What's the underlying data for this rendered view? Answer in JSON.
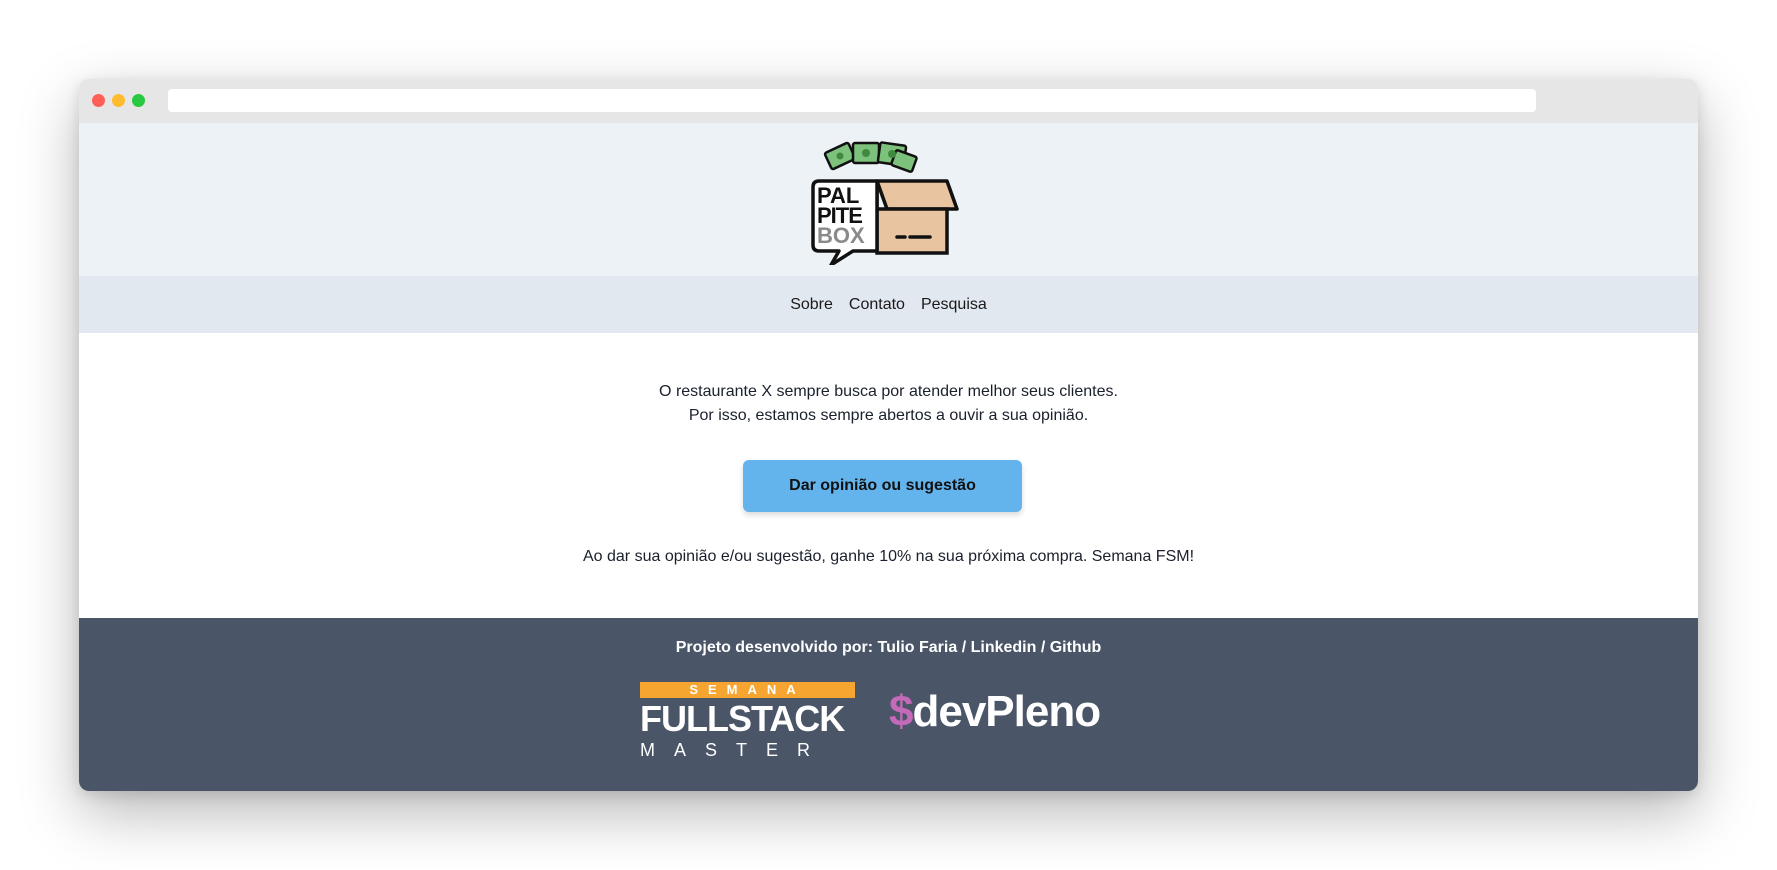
{
  "nav": {
    "items": [
      {
        "label": "Sobre"
      },
      {
        "label": "Contato"
      },
      {
        "label": "Pesquisa"
      }
    ]
  },
  "logo": {
    "lines": [
      "PAL",
      "PITE",
      "BOX"
    ]
  },
  "main": {
    "intro_line1": "O restaurante X sempre busca por atender melhor seus clientes.",
    "intro_line2": "Por isso, estamos sempre abertos a ouvir a sua opinião.",
    "cta_label": "Dar opinião ou sugestão",
    "promo": "Ao dar sua opinião e/ou sugestão, ganhe 10% na sua próxima compra. Semana FSM!"
  },
  "footer": {
    "credits_prefix": "Projeto desenvolvido por: ",
    "author": "Tulio Faria",
    "sep1": " / ",
    "linkedin": "Linkedin",
    "sep2": " / ",
    "github": "Github",
    "fsm_top": "SEMANA",
    "fsm_big": "FULLSTACK",
    "fsm_bottom": "MASTER",
    "devpleno_symbol": "$",
    "devpleno_text": "devPleno"
  },
  "colors": {
    "header_bg": "#edf2f7",
    "nav_bg": "#e2e8f0",
    "cta_bg": "#63b3ed",
    "footer_bg": "#4a5568",
    "fsm_orange": "#f6a531",
    "devpleno_pink": "#c569b9"
  }
}
